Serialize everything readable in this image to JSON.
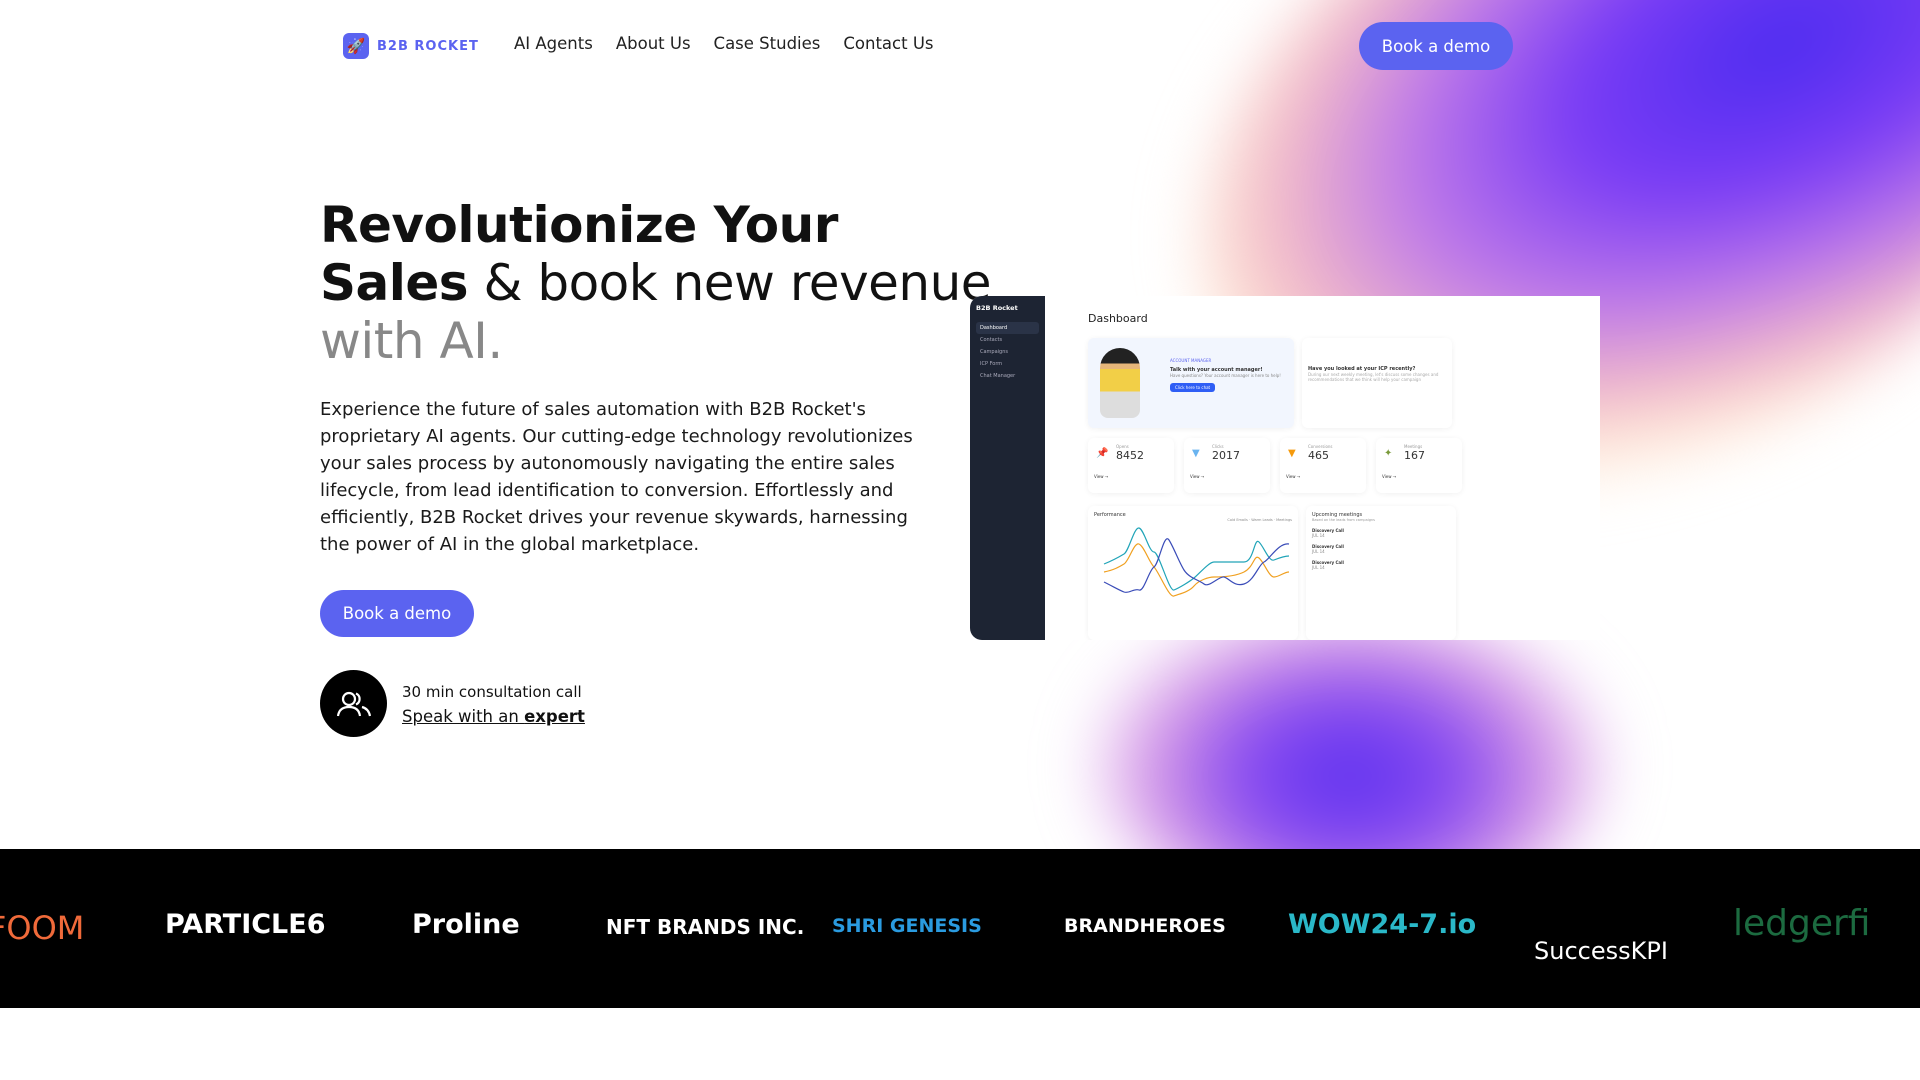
{
  "header": {
    "brand": "B2B ROCKET",
    "nav": [
      "AI Agents",
      "About Us",
      "Case Studies",
      "Contact Us"
    ],
    "cta": "Book a demo"
  },
  "hero": {
    "title_bold1": "Revolutionize Your",
    "title_bold2": "Sales",
    "title_rest": " & book new revenue",
    "title_light": "with AI.",
    "paragraph": "Experience the future of sales automation with B2B Rocket's proprietary AI agents. Our cutting-edge technology revolutionizes your sales process by autonomously navigating the entire sales lifecycle, from lead identification to conversion. Effortlessly and efficiently, B2B Rocket drives your revenue skywards, harnessing the power of AI in the global marketplace.",
    "cta": "Book a demo",
    "consult": "30 min consultation call",
    "speak_prefix": "Speak with an ",
    "speak_bold": "expert"
  },
  "dashboard": {
    "brand": "B2B Rocket",
    "sidebar": [
      "Dashboard",
      "Contacts",
      "Campaigns",
      "ICP Form",
      "Chat Manager"
    ],
    "title": "Dashboard",
    "account_caption": "ACCOUNT MANAGER",
    "account_title": "Talk with your account manager!",
    "account_text": "Have questions? Your account manager is here to help!",
    "chat_btn": "Click here to chat",
    "icp_title": "Have you looked at your ICP recently?",
    "icp_text": "During our next weekly meeting, let's discuss some changes and recommendations that we think will help your campaign",
    "stats": [
      {
        "label": "Opens",
        "value": "8452"
      },
      {
        "label": "Clicks",
        "value": "2017"
      },
      {
        "label": "Conversions",
        "value": "465"
      },
      {
        "label": "Meetings",
        "value": "167"
      }
    ],
    "view": "View →",
    "performance": "Performance",
    "legend": [
      "Cold Emails",
      "Warm Leads",
      "Meetings"
    ],
    "meetings_title": "Upcoming meetings",
    "meetings_sub": "Based on the leads from campaigns",
    "meeting_label": "Discovery Call",
    "meeting_date": "JUL 14"
  },
  "logos": [
    "FOOM",
    "PARTICLE6",
    "Proline",
    "NFT BRANDS INC.",
    "SHRI GENESIS",
    "BRANDHEROES",
    "WOW24-7.io",
    "SuccessKPI",
    "ledgerfi"
  ],
  "colors": {
    "accent": "#5b63f0",
    "band": "#000000"
  }
}
